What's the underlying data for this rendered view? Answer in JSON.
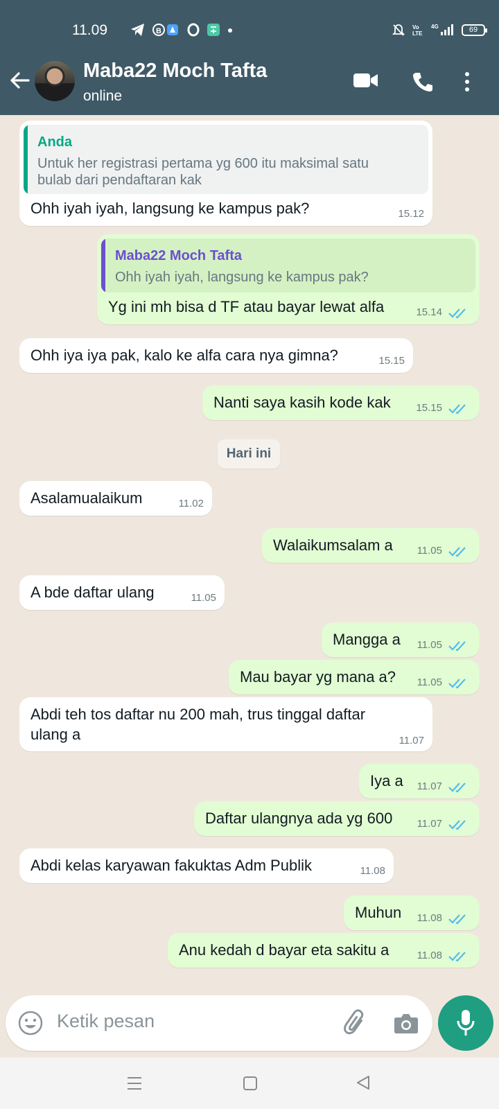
{
  "status_bar": {
    "time": "11.09",
    "battery": "69",
    "network": "4G"
  },
  "header": {
    "contact_name": "Maba22 Moch Tafta",
    "contact_status": "online"
  },
  "messages": [
    {
      "dir": "in",
      "quote_name": "Anda",
      "quote_text_1": "Untuk her registrasi pertama yg 600 itu maksimal satu",
      "quote_text_2": "bulab dari pendaftaran kak",
      "text": "Ohh iyah iyah, langsung ke kampus pak?",
      "time": "15.12"
    },
    {
      "dir": "out",
      "quote_name": "Maba22 Moch Tafta",
      "quote_text_1": "Ohh iyah iyah, langsung ke kampus pak?",
      "text": "Yg ini mh bisa d TF atau bayar lewat alfa",
      "time": "15.14"
    },
    {
      "dir": "in",
      "text": "Ohh iya iya pak, kalo ke alfa cara nya gimna?",
      "time": "15.15"
    },
    {
      "dir": "out",
      "text": "Nanti saya kasih kode kak",
      "time": "15.15"
    },
    {
      "dir": "in",
      "text": "Asalamualaikum",
      "time": "11.02"
    },
    {
      "dir": "out",
      "text": "Walaikumsalam a",
      "time": "11.05"
    },
    {
      "dir": "in",
      "text": "A bde daftar ulang",
      "time": "11.05"
    },
    {
      "dir": "out",
      "text": "Mangga a",
      "time": "11.05"
    },
    {
      "dir": "out",
      "text": "Mau bayar yg mana a?",
      "time": "11.05"
    },
    {
      "dir": "in",
      "text_1": "Abdi teh tos daftar nu 200 mah, trus tinggal daftar",
      "text_2": "ulang a",
      "time": "11.07"
    },
    {
      "dir": "out",
      "text": "Iya a",
      "time": "11.07"
    },
    {
      "dir": "out",
      "text": "Daftar ulangnya ada yg 600",
      "time": "11.07"
    },
    {
      "dir": "in",
      "text": "Abdi kelas karyawan fakuktas Adm Publik",
      "time": "11.08"
    },
    {
      "dir": "out",
      "text": "Muhun",
      "time": "11.08"
    },
    {
      "dir": "out",
      "text": "Anu kedah d bayar eta sakitu a",
      "time": "11.08"
    }
  ],
  "date_separator": "Hari ini",
  "input": {
    "placeholder": "Ketik pesan"
  },
  "colors": {
    "header": "#3f5a66",
    "chat_bg": "#efe7dd",
    "outgoing_bubble": "#e2fcd3",
    "incoming_bubble": "#ffffff",
    "accent_green": "#1f9e82",
    "read_ticks": "#53bdeb",
    "quote_you": "#06a884",
    "quote_contact": "#6b4fcf"
  },
  "icons": [
    "back-arrow-icon",
    "video-call-icon",
    "phone-icon",
    "more-vert-icon",
    "emoji-icon",
    "attach-clip-icon",
    "camera-icon",
    "mic-icon"
  ]
}
